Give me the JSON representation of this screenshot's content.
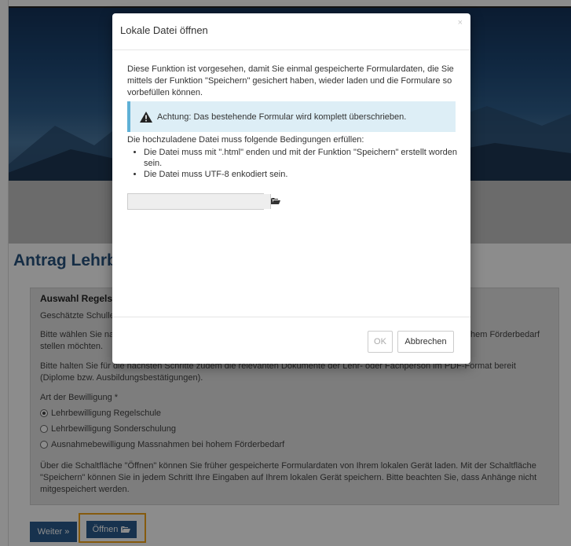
{
  "page": {
    "title": "Antrag Lehrbewilligung",
    "section_heading": "Auswahl Regelschule",
    "estimated_school_label": "Geschätzte Schulleitung",
    "intro_line1_left": "Bitte wählen Sie nachfolgend aus, ob Sie eine Lehrbewilligung für die Regelschule, die Sonderschulung oder Ausnahmebewilligung für Massnahmen bei hohem Förderbedarf",
    "intro_line1_right": "hem Förderbedarf",
    "intro_line2": "stellen möchten.",
    "pdf_hint": "Bitte halten Sie für die nächsten Schritte zudem die relevanten Dokumente der Lehr- oder Fachperson im PDF-Format bereit (Diplome bzw. Ausbildungsbestätigungen).",
    "type_label": "Art der Bewilligung *",
    "options": [
      {
        "label": "Lehrbewilligung Regelschule",
        "selected": true
      },
      {
        "label": "Lehrbewilligung Sonderschulung",
        "selected": false
      },
      {
        "label": "Ausnahmebewilligung Massnahmen bei hohem Förderbedarf",
        "selected": false
      }
    ],
    "footer_note": "Über die Schaltfläche \"Öffnen\" können Sie früher gespeicherte Formulardaten von Ihrem lokalen Gerät laden. Mit der Schaltfläche \"Speichern\" können Sie in jedem Schritt Ihre Eingaben auf Ihrem lokalen Gerät speichern. Bitte beachten Sie, dass Anhänge nicht mitgespeichert werden.",
    "next_label": "Weiter",
    "open_label": "Öffnen"
  },
  "modal": {
    "title": "Lokale Datei öffnen",
    "close": "×",
    "description": "Diese Funktion ist vorgesehen, damit Sie einmal gespeicherte Formulardaten, die Sie mittels der Funktion \"Speichern\" gesichert haben, wieder laden und die Formulare so vorbefüllen können.",
    "alert": "Achtung: Das bestehende Formular wird komplett überschrieben.",
    "conditions_intro": "Die hochzuladene Datei muss folgende Bedingungen erfüllen:",
    "conditions": [
      "Die Datei muss mit \".html\" enden und mit der Funktion \"Speichern\" erstellt worden sein.",
      "Die Datei muss UTF-8 enkodiert sein."
    ],
    "ok_label": "OK",
    "cancel_label": "Abbrechen"
  },
  "icons": {
    "folder": "folder-open-icon",
    "warning": "warning-icon",
    "next": "double-chevron-right-icon"
  },
  "colors": {
    "brand_blue": "#2a5c8f",
    "title_blue": "#27527e",
    "highlight_orange": "#f2a51a",
    "alert_bg": "#ddeef6"
  }
}
